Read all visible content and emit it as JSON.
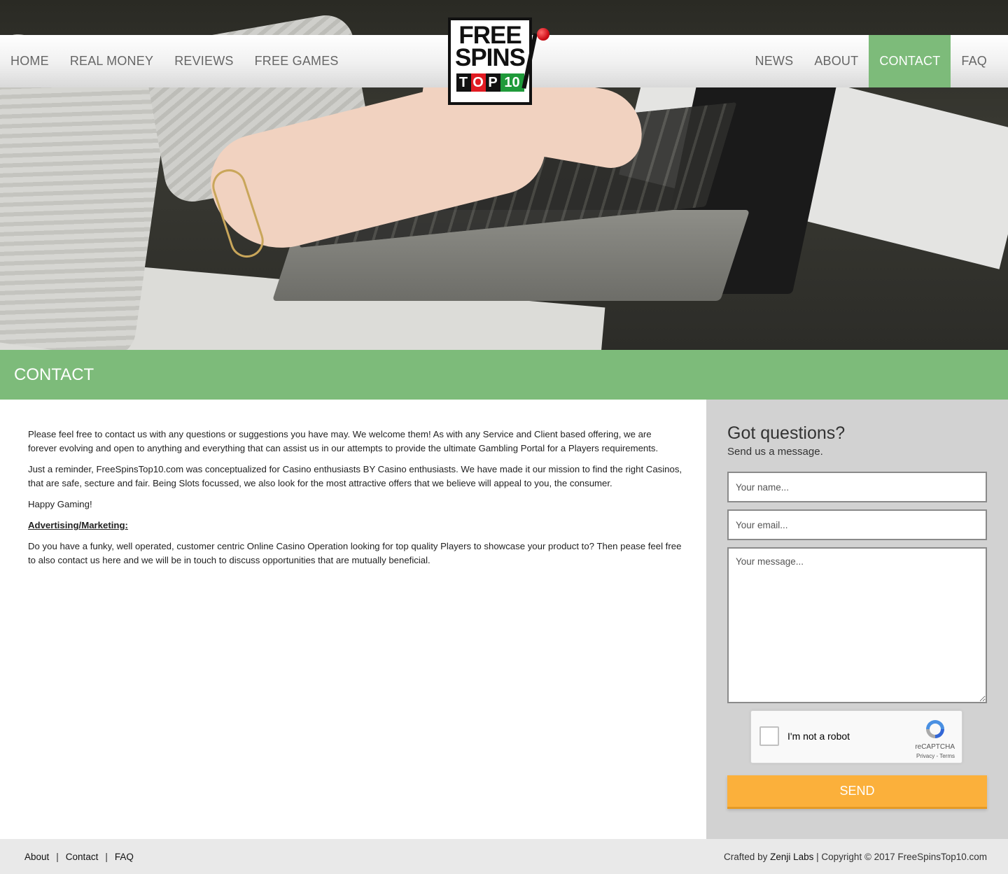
{
  "nav": {
    "left": [
      "HOME",
      "REAL MONEY",
      "REVIEWS",
      "FREE GAMES"
    ],
    "right": [
      "NEWS",
      "ABOUT",
      "CONTACT",
      "FAQ"
    ],
    "active": "CONTACT"
  },
  "logo": {
    "line1": "FREE",
    "line2": "SPINS",
    "t": "T",
    "o": "O",
    "p": "P",
    "ten": "10"
  },
  "page": {
    "title": "CONTACT"
  },
  "content": {
    "p1": "Please feel free to contact us with any questions or suggestions you have may.  We welcome them!   As with any Service and Client based offering, we are forever evolving and open to anything and everything that can assist us in our attempts to provide the ultimate Gambling Portal for a Players requirements.",
    "p2": "Just a reminder, FreeSpinsTop10.com was conceptualized for Casino enthusiasts BY Casino enthusiasts. We have made it our mission to find the right Casinos, that are safe, secture and fair. Being Slots focussed, we also look for the most attractive offers that we believe will appeal to you, the consumer.",
    "p3": "Happy Gaming!",
    "heading": "Advertising/Marketing:",
    "p4": "Do you have a funky, well operated, customer centric Online Casino Operation looking for top quality Players to showcase your product to? Then pease feel free to also contact us here and we will be in touch to discuss opportunities that are mutually beneficial."
  },
  "form": {
    "title": "Got questions?",
    "subtitle": "Send us a message.",
    "name_placeholder": "Your name...",
    "email_placeholder": "Your email...",
    "message_placeholder": "Your message...",
    "captcha_label": "I'm not a robot",
    "captcha_brand": "reCAPTCHA",
    "captcha_links": "Privacy - Terms",
    "send_label": "SEND"
  },
  "footer": {
    "links": [
      "About",
      "Contact",
      "FAQ"
    ],
    "separator": "|",
    "crafted_prefix": "Crafted by",
    "crafted_brand": "Zenji Labs",
    "copyright": "| Copyright © 2017 FreeSpinsTop10.com"
  },
  "colors": {
    "accent_green": "#7dbb7a",
    "send_orange": "#fbb03b",
    "sidebar_gray": "#d2d2d2"
  }
}
